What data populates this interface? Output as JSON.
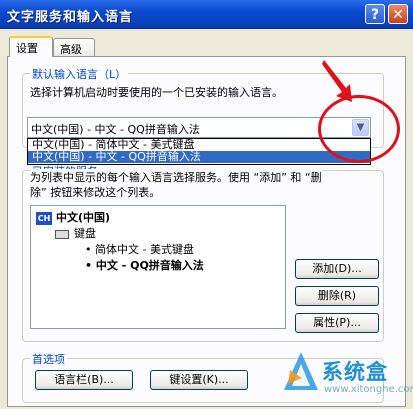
{
  "window": {
    "title": "文字服务和输入语言",
    "help_glyph": "?",
    "close_glyph": "✕"
  },
  "tabs": [
    {
      "label": "设置"
    },
    {
      "label": "高级"
    }
  ],
  "default_group": {
    "label": "默认输入语言（L）",
    "description": "选择计算机启动时要使用的一个已安装的输入语言。",
    "selected_value": "中文(中国) - 中文 - QQ拼音输入法",
    "options": [
      "中文(中国) - 简体中文 - 美式键盘",
      "中文(中国) - 中文 - QQ拼音输入法"
    ]
  },
  "installed_group": {
    "label": "已安装的服务",
    "description_line1": "为列表中显示的每个输入语言选择服务。使用 “添加” 和 “删",
    "description_line2": "除” 按钮来修改这个列表。",
    "tree": {
      "language": "中文(中国)",
      "language_badge": "CH",
      "category": "键盘",
      "items": [
        "简体中文 - 美式键盘",
        "中文 - QQ拼音输入法"
      ]
    },
    "buttons": {
      "add": "添加(D)...",
      "remove": "删除(R)",
      "properties": "属性(P)..."
    }
  },
  "preferences_group": {
    "label": "首选项",
    "language_bar_button": "语言栏(B)...",
    "key_settings_button": "键设置(K)..."
  },
  "watermark": {
    "name": "系统盒",
    "url": "www.xitonghe.com"
  },
  "colors": {
    "title_bar": "#0a4ad0",
    "selection": "#316ac5",
    "annotation": "#e0101a",
    "group_label": "#0046d5"
  }
}
